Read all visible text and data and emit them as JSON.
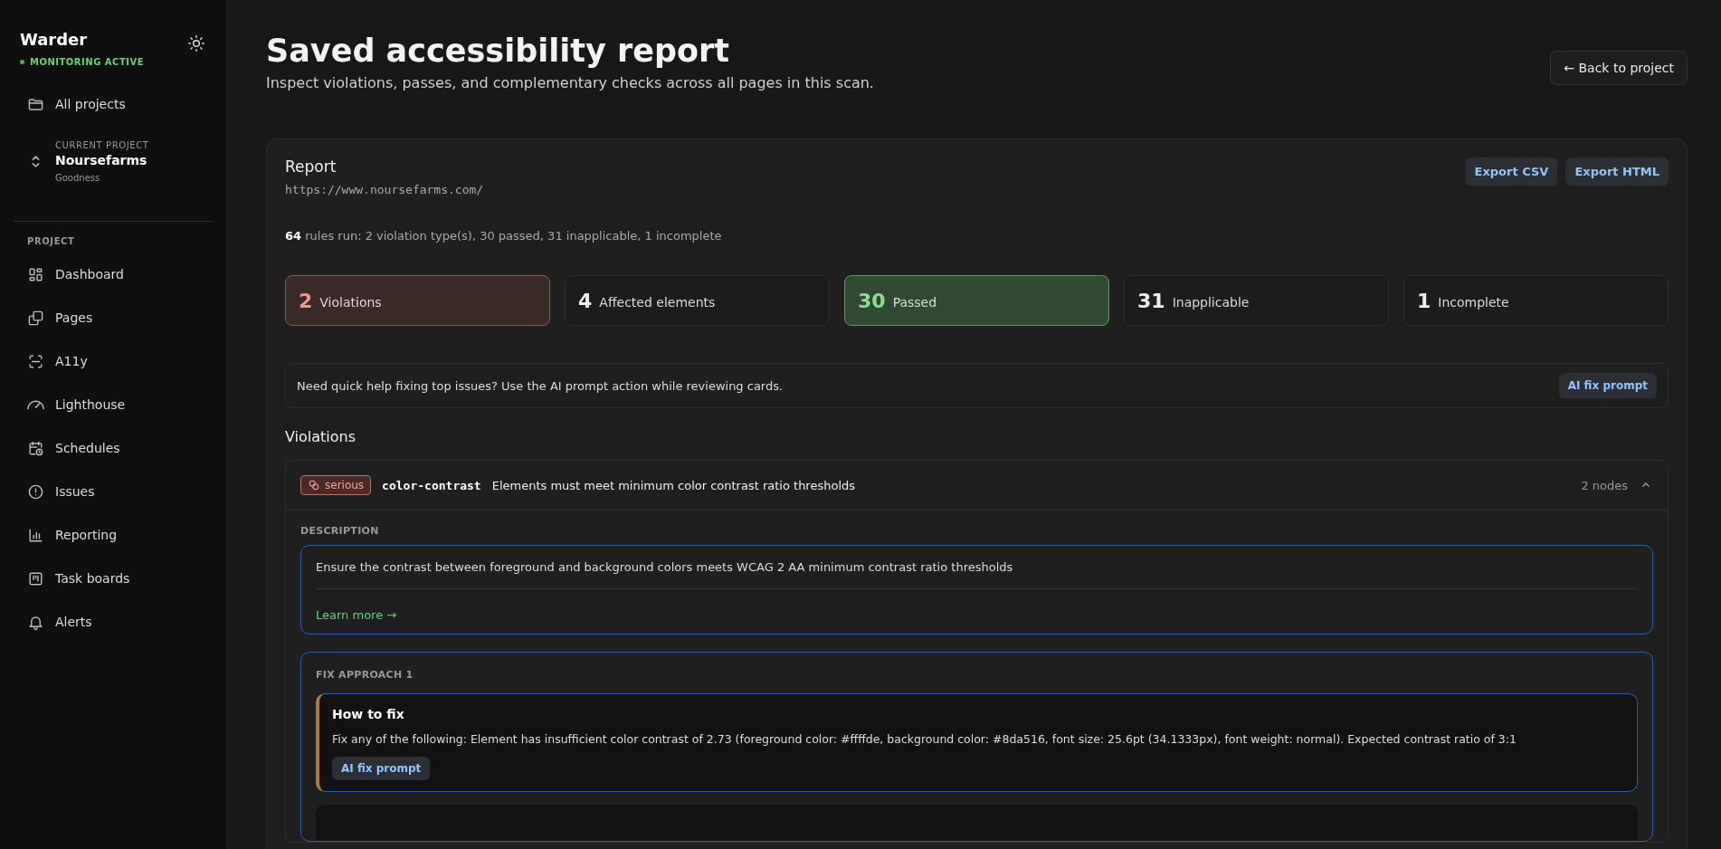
{
  "sidebar": {
    "brand": "Warder",
    "status": "MONITORING ACTIVE",
    "status_on": true,
    "top_items": [
      {
        "label": "All projects",
        "kind": "folder",
        "selected": false
      }
    ],
    "current_project": {
      "label": "CURRENT PROJECT",
      "name": "Noursefarms",
      "org": "Goodness"
    },
    "section": "PROJECT",
    "items": [
      {
        "label": "Dashboard",
        "kind": "dashboard",
        "selected": false
      },
      {
        "label": "Pages",
        "kind": "pages",
        "selected": false
      },
      {
        "label": "A11y",
        "kind": "scan",
        "selected": false
      },
      {
        "label": "Lighthouse",
        "kind": "gauge",
        "selected": false
      },
      {
        "label": "Schedules",
        "kind": "calendar",
        "selected": false
      },
      {
        "label": "Issues",
        "kind": "alert",
        "selected": false
      },
      {
        "label": "Reporting",
        "kind": "chart",
        "selected": false
      },
      {
        "label": "Task boards",
        "kind": "board",
        "selected": false
      },
      {
        "label": "Alerts",
        "kind": "bell",
        "selected": false
      }
    ]
  },
  "header": {
    "title": "Saved accessibility report",
    "subtitle": "Inspect violations, passes, and complementary checks across all pages in this scan.",
    "back_button": "← Back to project"
  },
  "report": {
    "title": "Report",
    "url": "https://www.noursefarms.com/",
    "actions": [
      "Export CSV",
      "Export HTML"
    ],
    "summary": "**64** rules run: 2 violation type(s), 30 passed, 31 inapplicable, 1 incomplete",
    "stats": [
      {
        "value": "2",
        "label": "Violations",
        "kind": "danger"
      },
      {
        "value": "4",
        "label": "Affected elements",
        "kind": "neutral"
      },
      {
        "value": "30",
        "label": "Passed",
        "kind": "success"
      },
      {
        "value": "31",
        "label": "Inapplicable",
        "kind": "neutral"
      },
      {
        "value": "1",
        "label": "Incomplete",
        "kind": "neutral"
      }
    ],
    "help": {
      "text": "Need quick help fixing top issues? Use the AI prompt action while reviewing cards.",
      "button": "AI fix prompt"
    },
    "violations_heading": "Violations",
    "violations": [
      {
        "severity": "serious",
        "rule": "color-contrast",
        "title": "Elements must meet minimum color contrast ratio thresholds",
        "nodes": "2 nodes",
        "expanded": true,
        "description_label": "DESCRIPTION",
        "description": "Ensure the contrast between foreground and background colors meets WCAG 2 AA minimum contrast ratio thresholds",
        "learn_more": "Learn more →",
        "fixes": [
          {
            "label": "FIX APPROACH 1",
            "heading": "How to fix",
            "text": "Fix any of the following: Element has insufficient color contrast of 2.73 (foreground color: #ffffde, background color: #8da516, font size: 25.6pt (34.1333px), font weight: normal). Expected contrast ratio of 3:1",
            "button": "AI fix prompt"
          }
        ]
      }
    ]
  }
}
